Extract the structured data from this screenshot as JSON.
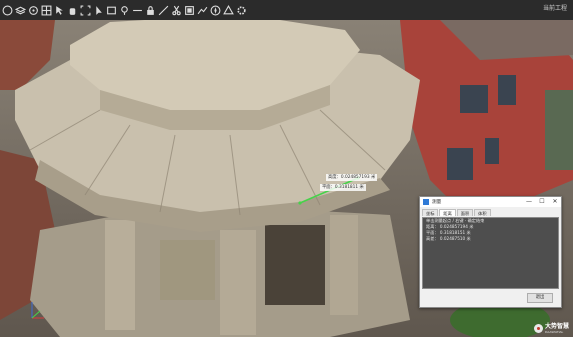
{
  "toolbar": {
    "icons": [
      "globe-icon",
      "layers-icon",
      "target-icon",
      "grid-icon",
      "arrow-icon",
      "hand-icon",
      "fullscreen-icon",
      "pointer-icon",
      "frame-icon",
      "lamp-icon",
      "minus-icon",
      "lock-icon",
      "measure-icon",
      "scissors-icon",
      "box-icon",
      "plot-icon",
      "compass-icon",
      "shape-icon",
      "gear-icon"
    ],
    "right_text": "当前工程"
  },
  "scene": {
    "labels": [
      "高度：0.024857193 米",
      "平面：0.3181811 米"
    ]
  },
  "dialog": {
    "title": "测量",
    "window_controls": [
      "—",
      "☐",
      "✕"
    ],
    "tabs": [
      "坐标",
      "距离",
      "面积",
      "体积"
    ],
    "active_tab": 1,
    "panel_lines": [
      "单击测量起点 / 右键 · 确定结束",
      "",
      "",
      "",
      "距离：  0.024857194  米",
      "平面：  0.31818151  米",
      "高差：  0.02487510  米"
    ],
    "close_label": "退出"
  },
  "brand": {
    "name": "大势智慧",
    "sub": "DAASPATIAL"
  }
}
